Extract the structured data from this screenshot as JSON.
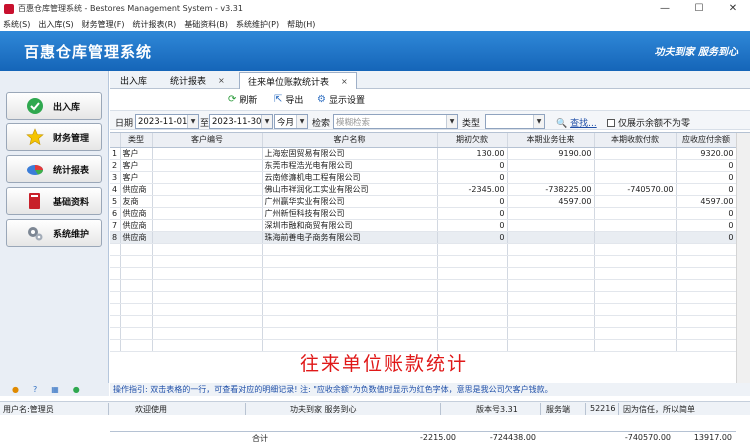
{
  "window": {
    "title": "百惠仓库管理系统 - Bestores Management System - v3.31",
    "minimize": "—",
    "maximize": "☐",
    "close": "✕"
  },
  "menu": [
    "系统(S)",
    "出入库(S)",
    "财务管理(F)",
    "统计报表(R)",
    "基础资料(B)",
    "系统维护(P)",
    "帮助(H)"
  ],
  "banner": {
    "app_title": "百惠仓库管理系统",
    "slogan": "功夫到家  服务到心"
  },
  "sidebar": {
    "items": [
      {
        "label": "出入库",
        "icon": "check-icon"
      },
      {
        "label": "财务管理",
        "icon": "star-icon"
      },
      {
        "label": "统计报表",
        "icon": "pie-chart-icon"
      },
      {
        "label": "基础资料",
        "icon": "book-icon"
      },
      {
        "label": "系统维护",
        "icon": "gears-icon"
      }
    ]
  },
  "tabs": [
    {
      "label": "出入库"
    },
    {
      "label": "统计报表",
      "close": "×"
    },
    {
      "label": "往来单位账款统计表",
      "close": "×"
    }
  ],
  "toolbar": {
    "refresh": "刷新",
    "export": "导出",
    "display_settings": "显示设置"
  },
  "filter": {
    "date_label": "日期",
    "date_from": "2023-11-01",
    "to_label": "至",
    "date_to": "2023-11-30",
    "period": "今月",
    "search_label": "检索",
    "search_placeholder": "模糊检索",
    "type_label": "类型",
    "type_value": "",
    "find_label": "查找...",
    "nonzero_label": "仅展示余额不为零",
    "nonzero_checked": false
  },
  "table": {
    "columns": [
      "",
      "类型",
      "客户编号",
      "客户名称",
      "期初欠款",
      "本期业务往来",
      "本期收款付款",
      "应收应付余额"
    ],
    "rows": [
      [
        "1",
        "客户",
        "",
        "上海宏固贸易有限公司",
        "130.00",
        "9190.00",
        "",
        "9320.00"
      ],
      [
        "2",
        "客户",
        "",
        "东莞市程浩光电有限公司",
        "0",
        "",
        "",
        "0"
      ],
      [
        "3",
        "客户",
        "",
        "云南修濂机电工程有限公司",
        "0",
        "",
        "",
        "0"
      ],
      [
        "4",
        "供应商",
        "",
        "佛山市祥润化工实业有限公司",
        "-2345.00",
        "-738225.00",
        "-740570.00",
        "0"
      ],
      [
        "5",
        "友商",
        "",
        "广州赢华实业有限公司",
        "0",
        "4597.00",
        "",
        "4597.00"
      ],
      [
        "6",
        "供应商",
        "",
        "广州新恒科技有限公司",
        "0",
        "",
        "",
        "0"
      ],
      [
        "7",
        "供应商",
        "",
        "深圳市融和商贸有限公司",
        "0",
        "",
        "",
        "0"
      ],
      [
        "8",
        "供应商",
        "",
        "珠海前善电子商务有限公司",
        "0",
        "",
        "",
        "0"
      ]
    ],
    "selected_row": 8
  },
  "overlay_text": "往来单位账款统计",
  "totals": {
    "label": "合计",
    "opening": "-2215.00",
    "business": "-724438.00",
    "payments": "-740570.00",
    "balance": "13917.00"
  },
  "hint": "操作指引: 双击表格的一行，可查看对应的明细记录! 注: \"应收余额\"为负数值时显示为红色字体，意思是我公司欠客户钱款。",
  "statusbar": {
    "user": "用户名:管理员",
    "welcome": "欢迎使用",
    "motto": "功夫到家 服务到心",
    "version": "版本号3.31",
    "service_label": "服务端",
    "service_port": "52216",
    "tagline": "因为信任，所以简单"
  },
  "colors": {
    "banner": "#1f74c8",
    "overlay_text": "#e01818",
    "hint_text": "#1f4fa8"
  }
}
